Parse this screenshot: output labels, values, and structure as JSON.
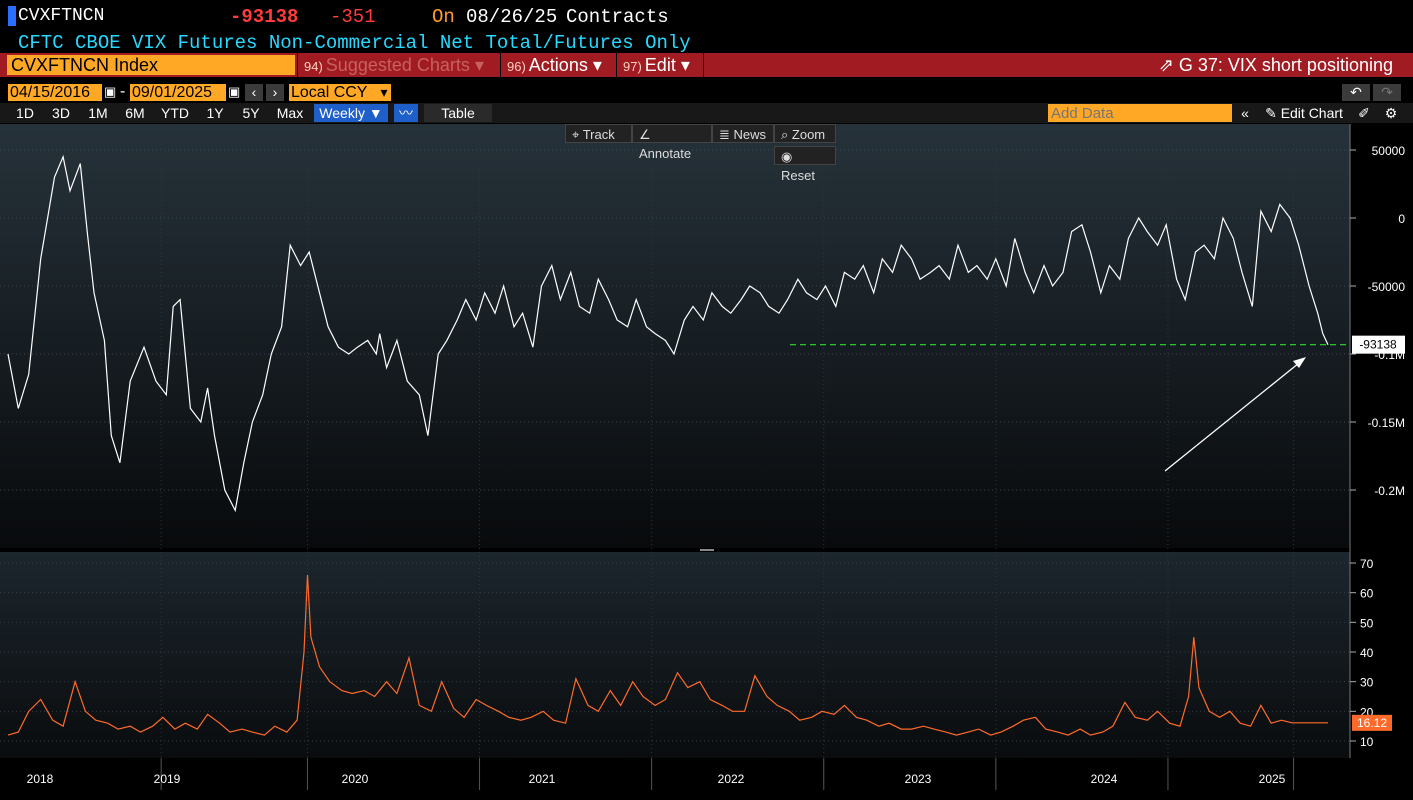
{
  "header": {
    "ticker": "CVXFTNCN",
    "last_value": "-93138",
    "change": "-351",
    "on_label": "On",
    "date": "08/26/25",
    "unit": "Contracts",
    "description": "CFTC CBOE VIX Futures Non-Commercial Net Total/Futures Only"
  },
  "toolbar": {
    "index_field": "CVXFTNCN Index",
    "suggested_num": "94)",
    "suggested_label": "Suggested Charts",
    "actions_num": "96)",
    "actions_label": "Actions",
    "edit_num": "97)",
    "edit_label": "Edit",
    "chart_title": "G 37: VIX short positioning"
  },
  "range": {
    "start_date": "04/15/2016",
    "end_date": "09/01/2025",
    "currency": "Local CCY",
    "periods": [
      "1D",
      "3D",
      "1M",
      "6M",
      "YTD",
      "1Y",
      "5Y",
      "Max"
    ],
    "frequency": "Weekly",
    "table_label": "Table",
    "add_data_placeholder": "Add Data",
    "edit_chart_label": "Edit Chart"
  },
  "chart_tools": {
    "track": "Track",
    "annotate": "Annotate",
    "news": "News",
    "zoom": "Zoom",
    "reset": "Reset"
  },
  "colors": {
    "upper_line": "#ffffff",
    "lower_line": "#ff6a2a",
    "last_value_line": "#2fdc2f",
    "bar_red": "#a01c22",
    "orange_field": "#ffa826"
  },
  "chart_data": [
    {
      "type": "line",
      "series": [
        {
          "name": "CVXFTNCN",
          "x": [
            2017.66,
            2017.72,
            2017.78,
            2017.85,
            2017.93,
            2017.98,
            2018.02,
            2018.08,
            2018.12,
            2018.16,
            2018.22,
            2018.26,
            2018.31,
            2018.37,
            2018.45,
            2018.52,
            2018.58,
            2018.62,
            2018.66,
            2018.72,
            2018.78,
            2018.82,
            2018.86,
            2018.92,
            2018.98,
            2019.03,
            2019.08,
            2019.14,
            2019.19,
            2019.25,
            2019.3,
            2019.36,
            2019.41,
            2019.47,
            2019.52,
            2019.58,
            2019.64,
            2019.69,
            2019.75,
            2019.8,
            2019.82,
            2019.86,
            2019.92,
            2019.98,
            2020.05,
            2020.1,
            2020.16,
            2020.21,
            2020.27,
            2020.32,
            2020.38,
            2020.43,
            2020.49,
            2020.54,
            2020.6,
            2020.65,
            2020.71,
            2020.76,
            2020.82,
            2020.87,
            2020.93,
            2020.98,
            2021.04,
            2021.09,
            2021.15,
            2021.2,
            2021.26,
            2021.31,
            2021.37,
            2021.42,
            2021.48,
            2021.53,
            2021.59,
            2021.64,
            2021.7,
            2021.75,
            2021.81,
            2021.86,
            2021.92,
            2021.97,
            2022.03,
            2022.08,
            2022.14,
            2022.19,
            2022.25,
            2022.3,
            2022.36,
            2022.41,
            2022.47,
            2022.52,
            2022.58,
            2022.63,
            2022.69,
            2022.74,
            2022.8,
            2022.85,
            2022.91,
            2022.96,
            2023.02,
            2023.07,
            2023.13,
            2023.18,
            2023.24,
            2023.29,
            2023.35,
            2023.4,
            2023.46,
            2023.51,
            2023.57,
            2023.62,
            2023.68,
            2023.73,
            2023.79,
            2023.84,
            2023.9,
            2023.95,
            2024.01,
            2024.06,
            2024.12,
            2024.17,
            2024.23,
            2024.28,
            2024.34,
            2024.39,
            2024.45,
            2024.5,
            2024.56,
            2024.61,
            2024.67,
            2024.72,
            2024.78,
            2024.83,
            2024.89,
            2024.94,
            2025.0,
            2025.05,
            2025.11,
            2025.16,
            2025.22,
            2025.27,
            2025.3,
            2025.33
          ],
          "values": [
            -100000,
            -140000,
            -115000,
            -30000,
            30000,
            45000,
            20000,
            40000,
            -10000,
            -55000,
            -90000,
            -160000,
            -180000,
            -120000,
            -95000,
            -120000,
            -130000,
            -65000,
            -60000,
            -140000,
            -150000,
            -125000,
            -160000,
            -200000,
            -215000,
            -180000,
            -150000,
            -130000,
            -100000,
            -80000,
            -20000,
            -35000,
            -25000,
            -55000,
            -80000,
            -95000,
            -100000,
            -95000,
            -90000,
            -100000,
            -85000,
            -110000,
            -90000,
            -120000,
            -130000,
            -160000,
            -100000,
            -90000,
            -75000,
            -60000,
            -75000,
            -55000,
            -70000,
            -50000,
            -80000,
            -70000,
            -95000,
            -50000,
            -35000,
            -60000,
            -40000,
            -65000,
            -70000,
            -45000,
            -60000,
            -75000,
            -80000,
            -60000,
            -80000,
            -85000,
            -90000,
            -100000,
            -75000,
            -65000,
            -75000,
            -55000,
            -65000,
            -70000,
            -60000,
            -50000,
            -55000,
            -65000,
            -70000,
            -60000,
            -45000,
            -55000,
            -60000,
            -50000,
            -65000,
            -40000,
            -45000,
            -35000,
            -55000,
            -30000,
            -40000,
            -20000,
            -30000,
            -45000,
            -40000,
            -35000,
            -45000,
            -20000,
            -40000,
            -35000,
            -45000,
            -30000,
            -50000,
            -15000,
            -40000,
            -55000,
            -35000,
            -50000,
            -40000,
            -10000,
            -5000,
            -25000,
            -55000,
            -35000,
            -45000,
            -15000,
            0,
            -10000,
            -20000,
            -5000,
            -45000,
            -60000,
            -25000,
            -20000,
            -30000,
            0,
            -15000,
            -40000,
            -65000,
            5000,
            -10000,
            10000,
            0,
            -20000,
            -50000,
            -70000,
            -85000,
            -93138
          ]
        }
      ],
      "ylim": [
        -240000,
        60000
      ],
      "yticks": [
        "50000",
        "0",
        "-50000",
        "-0.1M",
        "-0.15M",
        "-0.2M"
      ],
      "last_label": "-93138"
    },
    {
      "type": "line",
      "series": [
        {
          "name": "VIX",
          "x": [
            2017.66,
            2017.72,
            2017.78,
            2017.85,
            2017.92,
            2017.98,
            2018.05,
            2018.11,
            2018.17,
            2018.24,
            2018.3,
            2018.37,
            2018.43,
            2018.5,
            2018.56,
            2018.63,
            2018.69,
            2018.76,
            2018.82,
            2018.89,
            2018.95,
            2019.02,
            2019.08,
            2019.15,
            2019.21,
            2019.28,
            2019.34,
            2019.38,
            2019.4,
            2019.42,
            2019.47,
            2019.53,
            2019.6,
            2019.66,
            2019.73,
            2019.79,
            2019.86,
            2019.92,
            2019.99,
            2020.05,
            2020.12,
            2020.18,
            2020.25,
            2020.31,
            2020.38,
            2020.44,
            2020.51,
            2020.57,
            2020.64,
            2020.7,
            2020.77,
            2020.83,
            2020.9,
            2020.96,
            2021.03,
            2021.09,
            2021.16,
            2021.22,
            2021.29,
            2021.35,
            2021.42,
            2021.48,
            2021.55,
            2021.61,
            2021.68,
            2021.74,
            2021.81,
            2021.87,
            2021.94,
            2022.0,
            2022.07,
            2022.13,
            2022.2,
            2022.26,
            2022.33,
            2022.39,
            2022.46,
            2022.52,
            2022.59,
            2022.65,
            2022.72,
            2022.78,
            2022.85,
            2022.91,
            2022.98,
            2023.04,
            2023.11,
            2023.17,
            2023.24,
            2023.3,
            2023.37,
            2023.43,
            2023.5,
            2023.56,
            2023.63,
            2023.69,
            2023.76,
            2023.82,
            2023.89,
            2023.95,
            2024.02,
            2024.08,
            2024.15,
            2024.21,
            2024.28,
            2024.34,
            2024.41,
            2024.47,
            2024.52,
            2024.55,
            2024.58,
            2024.64,
            2024.7,
            2024.76,
            2024.82,
            2024.88,
            2024.94,
            2025.0,
            2025.06,
            2025.12,
            2025.18,
            2025.24,
            2025.3,
            2025.33
          ],
          "values": [
            12,
            13,
            20,
            24,
            17,
            15,
            30,
            20,
            17,
            16,
            14,
            15,
            13,
            15,
            18,
            14,
            16,
            14,
            19,
            16,
            13,
            14,
            13,
            12,
            15,
            13,
            17,
            40,
            66,
            45,
            35,
            30,
            27,
            26,
            27,
            25,
            30,
            26,
            38,
            22,
            20,
            30,
            21,
            18,
            24,
            22,
            20,
            18,
            17,
            18,
            20,
            17,
            16,
            31,
            22,
            20,
            27,
            22,
            30,
            25,
            22,
            24,
            33,
            28,
            30,
            24,
            22,
            20,
            20,
            32,
            25,
            22,
            20,
            17,
            18,
            20,
            19,
            22,
            18,
            17,
            15,
            16,
            14,
            14,
            15,
            14,
            13,
            12,
            13,
            14,
            12,
            13,
            15,
            17,
            18,
            14,
            13,
            12,
            14,
            12,
            13,
            15,
            23,
            18,
            17,
            20,
            16,
            15,
            25,
            45,
            28,
            20,
            18,
            20,
            16,
            15,
            22,
            16,
            17,
            16.12,
            16.12,
            16.12,
            16.12,
            16.12
          ],
          "values_note": ""
        }
      ],
      "ylim": [
        5,
        72
      ],
      "yticks": [
        "70",
        "60",
        "50",
        "40",
        "30",
        "20",
        "10"
      ],
      "last_label": "16.12"
    }
  ],
  "xaxis": {
    "labels": [
      "2018",
      "2019",
      "2020",
      "2021",
      "2022",
      "2023",
      "2024",
      "2025"
    ]
  }
}
